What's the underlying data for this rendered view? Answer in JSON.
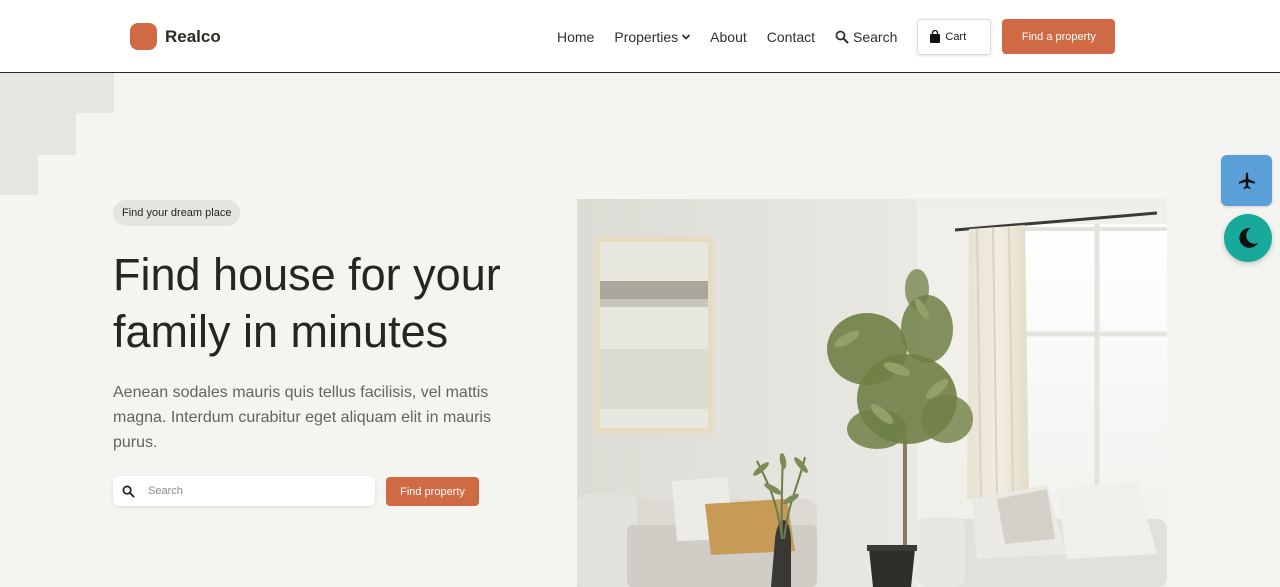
{
  "brand": {
    "name": "Realco",
    "accent_color": "#cf6a45"
  },
  "nav": {
    "home": "Home",
    "properties": "Properties",
    "about": "About",
    "contact": "Contact",
    "search": "Search",
    "cart": "Cart",
    "cta": "Find a property"
  },
  "hero": {
    "badge": "Find your dream place",
    "title": "Find house for your family in minutes",
    "description": "Aenean sodales mauris quis tellus facilisis, vel mattis magna. Interdum curabitur eget aliquam elit in mauris purus.",
    "search_placeholder": "Search",
    "search_button": "Find property"
  },
  "floating": {
    "plane_icon": "airplane-icon",
    "plane_color": "#5b9fd9",
    "theme_icon": "moon-icon",
    "theme_color": "#17a99b"
  }
}
